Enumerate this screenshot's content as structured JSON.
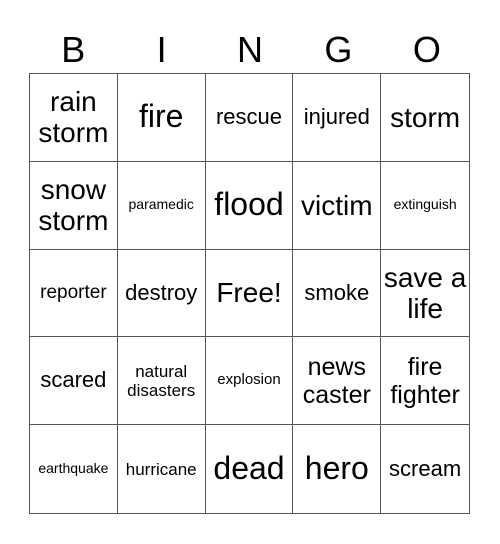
{
  "header": [
    "B",
    "I",
    "N",
    "G",
    "O"
  ],
  "cells": [
    "rain storm",
    "fire",
    "rescue",
    "injured",
    "storm",
    "snow storm",
    "paramedic",
    "flood",
    "victim",
    "extinguish",
    "reporter",
    "destroy",
    "Free!",
    "smoke",
    "save a life",
    "scared",
    "natural disasters",
    "explosion",
    "news caster",
    "fire fighter",
    "earthquake",
    "hurricane",
    "dead",
    "hero",
    "scream"
  ]
}
